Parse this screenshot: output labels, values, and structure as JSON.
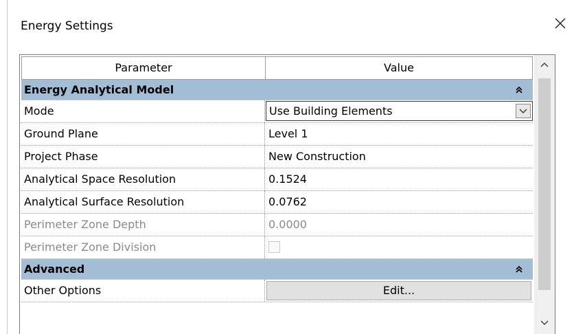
{
  "window": {
    "title": "Energy Settings"
  },
  "grid": {
    "headers": {
      "parameter": "Parameter",
      "value": "Value"
    },
    "groups": [
      {
        "label": "Energy Analytical Model",
        "rows": [
          {
            "parameter": "Mode",
            "value": "Use Building Elements",
            "editor": "dropdown",
            "enabled": true
          },
          {
            "parameter": "Ground Plane",
            "value": "Level 1",
            "editor": "text",
            "enabled": true
          },
          {
            "parameter": "Project Phase",
            "value": "New Construction",
            "editor": "text",
            "enabled": true
          },
          {
            "parameter": "Analytical Space Resolution",
            "value": "0.1524",
            "editor": "text",
            "enabled": true
          },
          {
            "parameter": "Analytical Surface Resolution",
            "value": "0.0762",
            "editor": "text",
            "enabled": true
          },
          {
            "parameter": "Perimeter Zone Depth",
            "value": "0.0000",
            "editor": "text",
            "enabled": false
          },
          {
            "parameter": "Perimeter Zone Division",
            "value": false,
            "editor": "checkbox",
            "enabled": false
          }
        ]
      },
      {
        "label": "Advanced",
        "rows": [
          {
            "parameter": "Other Options",
            "value": "Edit...",
            "editor": "button",
            "enabled": true
          }
        ]
      }
    ]
  },
  "icons": {
    "close": "close-icon",
    "collapse": "double-chevron-up-icon",
    "dropdown": "chevron-down-icon",
    "scroll_up": "chevron-up-icon",
    "scroll_down": "chevron-down-icon"
  },
  "colors": {
    "group_header_bg": "#a4bdd6",
    "disabled_text": "#8a8a8a",
    "button_bg": "#e1e1e1"
  }
}
